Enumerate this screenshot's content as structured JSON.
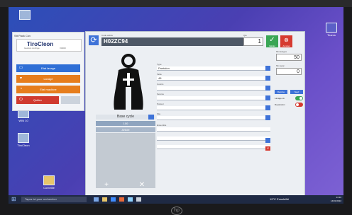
{
  "left_panel": {
    "title": "Stt Pack Cov",
    "logo_text": "TiroCleon",
    "logo_sub": "Gestion du linge",
    "logo_sub2": "V0000",
    "buttons": [
      "Etat lavage",
      "Lavage",
      "Etat machine",
      "Quitter"
    ]
  },
  "main": {
    "code_label": "Code article",
    "code_value": "H02ZC94",
    "qty_label": "Qte",
    "qty_value": "1",
    "ok_label": "Valider",
    "cancel_label": "Annuler",
    "cycle_label": "Base cycle",
    "row1": "100",
    "row2": "Article",
    "fields": [
      {
        "label": "Type",
        "value": "Pantalon"
      },
      {
        "label": "Taille",
        "value": "48"
      },
      {
        "label": "Coloris",
        "value": ""
      },
      {
        "label": "Service",
        "value": ""
      },
      {
        "label": "Porteur",
        "value": ""
      },
      {
        "label": "Site",
        "value": ""
      },
      {
        "label": "Ensemble",
        "value": ""
      },
      {
        "label": "",
        "value": ""
      },
      {
        "label": "",
        "value": ""
      }
    ],
    "right": {
      "lavages_label": "Nb lavages",
      "lavages_value": "50",
      "reparations_label": "Nb repar.",
      "reparations_value": "0",
      "pair_a": "Reprise",
      "pair_b": "Neuf",
      "toggle1_label": "Lavage ok",
      "toggle2_label": "Reparation"
    }
  },
  "desktop": {
    "icon1": "WIN 10",
    "icon2": "TiroCleon",
    "icon3": "Corbeille",
    "icon4": "Teams"
  },
  "taskbar": {
    "search_placeholder": "Tapez ici pour rechercher",
    "tray": "19°C Ensoleillé",
    "time": "14:10",
    "date": "14/01/2022"
  }
}
